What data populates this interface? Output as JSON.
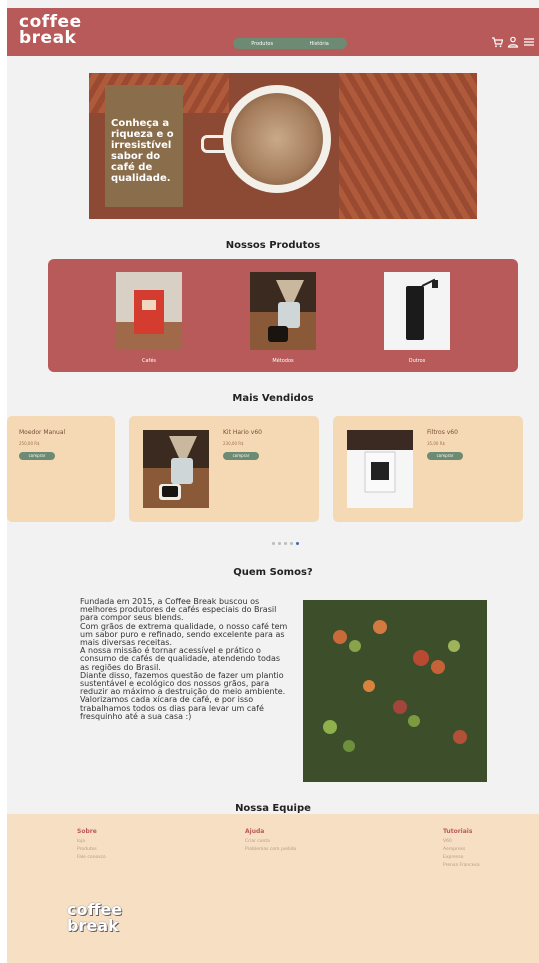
{
  "header": {
    "logo_line1": "coffee",
    "logo_line2": "break",
    "nav": [
      "Produtos",
      "História"
    ],
    "icons": [
      "cart-icon",
      "user-icon",
      "menu-icon"
    ],
    "color": "#b85a5a"
  },
  "hero": {
    "text": "Conheça a riqueza e o irresistível sabor do café de qualidade."
  },
  "products": {
    "title": "Nossos Produtos",
    "items": [
      {
        "label": "Cafés"
      },
      {
        "label": "Métodos"
      },
      {
        "label": "Outros"
      }
    ]
  },
  "best_sellers": {
    "title": "Mais Vendidos",
    "items": [
      {
        "name": "Moedor Manual",
        "price": "250,00 R$",
        "button": "comprar"
      },
      {
        "name": "Kit Hario v60",
        "price": "230,00 R$",
        "button": "comprar"
      },
      {
        "name": "Filtros v60",
        "price": "35,00 R$",
        "button": "comprar"
      }
    ]
  },
  "about": {
    "title": "Quem Somos?",
    "paragraphs": [
      "Fundada em 2015, a Coffee Break buscou os melhores produtores de cafés especiais do Brasil para compor seus blends.",
      "Com grãos de extrema qualidade, o nosso café tem um sabor puro e refinado, sendo excelente para as mais diversas receitas.",
      "A nossa missão é tornar acessível e prático o consumo de cafés de qualidade, atendendo todas as regiões do Brasil.",
      "Diante disso, fazemos questão de fazer um plantio sustentável e ecológico dos nossos grãos, para reduzir ao máximo a destruição do meio ambiente.",
      "Valorizamos cada xícara de café, e por isso trabalhamos todos os dias para levar um café fresquinho até a sua casa :)"
    ]
  },
  "team": {
    "title": "Nossa Equipe"
  },
  "footer": {
    "columns": [
      {
        "heading": "Sobre",
        "items": [
          "loja",
          "Produtos",
          "Fale conosco"
        ]
      },
      {
        "heading": "Ajuda",
        "items": [
          "Criar conta",
          "Problemas com pedido"
        ]
      },
      {
        "heading": "Tutoriais",
        "items": [
          "V60",
          "Aeropress",
          "Expresso",
          "Prensa Francesa"
        ]
      }
    ],
    "logo_line1": "coffee",
    "logo_line2": "break"
  }
}
